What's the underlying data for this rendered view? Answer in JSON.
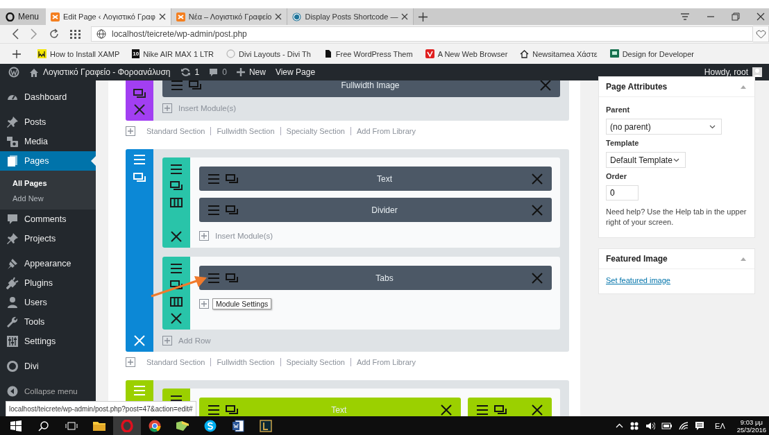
{
  "browser": {
    "menu_label": "Menu",
    "tabs": [
      {
        "label": "Edit Page ‹ Λογιστικό Γραφ",
        "selected": true
      },
      {
        "label": "Νέα – Λογιστικό Γραφείο",
        "selected": false
      },
      {
        "label": "Display Posts Shortcode —",
        "selected": false
      }
    ],
    "url": "localhost/teicrete/wp-admin/post.php",
    "bookmarks": [
      {
        "label": "How to Install XAMP"
      },
      {
        "badge": "10",
        "label": "Nike AIR MAX 1 LTR"
      },
      {
        "label": "Divi Layouts - Divi Th"
      },
      {
        "label": "Free WordPress Them"
      },
      {
        "label": "A New Web Browser"
      },
      {
        "label": "Newsitamea Χάστε"
      },
      {
        "label": "Design for Developer"
      }
    ]
  },
  "admin_bar": {
    "site_name": "Λογιστικό Γραφείο - Φοροανάλυση",
    "updates": "1",
    "comments": "0",
    "new_label": "New",
    "view_label": "View Page",
    "greeting": "Howdy, root"
  },
  "sidebar": {
    "groups": [
      [
        {
          "label": "Dashboard",
          "selected": false
        }
      ],
      [
        {
          "label": "Posts",
          "selected": false
        },
        {
          "label": "Media",
          "selected": false
        },
        {
          "label": "Pages",
          "selected": true,
          "children": [
            {
              "label": "All Pages",
              "selected": true
            },
            {
              "label": "Add New",
              "selected": false
            }
          ]
        },
        {
          "label": "Comments",
          "selected": false
        },
        {
          "label": "Projects",
          "selected": false
        }
      ],
      [
        {
          "label": "Appearance",
          "selected": false
        },
        {
          "label": "Plugins",
          "selected": false
        },
        {
          "label": "Users",
          "selected": false
        },
        {
          "label": "Tools",
          "selected": false
        },
        {
          "label": "Settings",
          "selected": false
        }
      ],
      [
        {
          "label": "Divi",
          "selected": false
        }
      ]
    ],
    "collapse_label": "Collapse menu"
  },
  "builder": {
    "blocks": [
      {
        "kind": "fullwidth_section",
        "color": "#a23ff2",
        "modules": [
          {
            "title": "Fullwidth Image",
            "color": "#4c5866"
          }
        ],
        "insert_label": "Insert Module(s)"
      },
      {
        "kind": "links",
        "items": [
          "Standard Section",
          "Fullwidth Section",
          "Specialty Section",
          "Add From Library"
        ]
      },
      {
        "kind": "section",
        "color": "#0c88d6",
        "add_row_label": "Add Row",
        "rows": [
          {
            "color": "#29c4a9",
            "columns": [
              {
                "modules": [
                  {
                    "title": "Text",
                    "color": "#4c5866"
                  },
                  {
                    "title": "Divider",
                    "color": "#4c5866"
                  }
                ],
                "insert_label": "Insert Module(s)"
              }
            ]
          },
          {
            "color": "#29c4a9",
            "columns": [
              {
                "modules": [
                  {
                    "title": "Tabs",
                    "color": "#4c5866"
                  }
                ],
                "tooltip": "Module Settings"
              }
            ]
          }
        ]
      },
      {
        "kind": "links",
        "items": [
          "Standard Section",
          "Fullwidth Section",
          "Specialty Section",
          "Add From Library"
        ]
      },
      {
        "kind": "section",
        "color": "#9bd000",
        "rows": [
          {
            "color": "#9bd000",
            "columns": [
              {
                "modules": [
                  {
                    "title": "Text",
                    "color": "#9bd000"
                  }
                ]
              },
              {
                "modules": [
                  {
                    "color": "#9bd000"
                  }
                ]
              }
            ]
          }
        ]
      }
    ]
  },
  "page_attributes": {
    "title": "Page Attributes",
    "parent_label": "Parent",
    "parent_value": "(no parent)",
    "template_label": "Template",
    "template_value": "Default Template",
    "order_label": "Order",
    "order_value": "0",
    "help": "Need help? Use the Help tab in the upper right of your screen."
  },
  "featured_image": {
    "title": "Featured Image",
    "link": "Set featured image"
  },
  "status_url": "localhost/teicrete/wp-admin/post.php?post=47&action=edit#",
  "taskbar": {
    "language": "ΕΛ",
    "time": "9:03 μμ",
    "date": "25/3/2016"
  }
}
